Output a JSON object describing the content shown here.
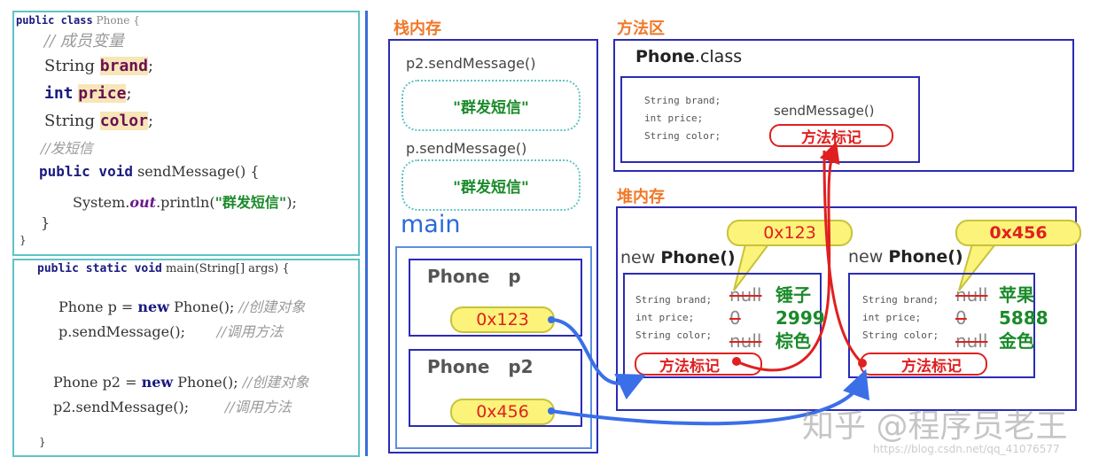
{
  "code_class": {
    "line1_kw": "public class",
    "line1_name": "Phone {",
    "comment1": "// 成员变量",
    "f1_type": "String",
    "f1_name": "brand",
    "f2_type": "int",
    "f2_name": "price",
    "f3_type": "String",
    "f3_name": "color",
    "comment2": "//发短信",
    "method_kw": "public void",
    "method_sig": "sendMessage() {",
    "print_pre": "System.",
    "print_out": "out",
    "print_mid": ".println(",
    "print_str": "\"群发短信\"",
    "print_end": ");",
    "close_inner": "}",
    "close_outer": "}"
  },
  "code_main": {
    "sig_kw": "public static void",
    "sig_rest": "main(String[] args) {",
    "l1": "Phone p = ",
    "l1_new": "new",
    "l1_rest": " Phone();",
    "l1_cmt": "//创建对象",
    "l2": "p.sendMessage();",
    "l2_cmt": "//调用方法",
    "l3": "Phone p2 = ",
    "l3_new": "new",
    "l3_rest": " Phone();",
    "l3_cmt": "//创建对象",
    "l4": "p2.sendMessage();",
    "l4_cmt": "//调用方法",
    "close": "}"
  },
  "stack": {
    "title": "栈内存",
    "frame1_label": "p2.sendMessage()",
    "frame1_text": "\"群发短信\"",
    "frame2_label": "p.sendMessage()",
    "frame2_text": "\"群发短信\"",
    "main_label": "main",
    "var1": "Phone   p",
    "var1_val": "0x123",
    "var2": "Phone   p2",
    "var2_val": "0x456"
  },
  "method_area": {
    "title": "方法区",
    "class_bold": "Phone",
    "class_rest": ".class",
    "f1": "String brand;",
    "f2": "int price;",
    "f3": "String color;",
    "method": "sendMessage()",
    "mark": "方法标记"
  },
  "heap": {
    "title": "堆内存",
    "objects": [
      {
        "new": "new",
        "name": "Phone()",
        "addr": "0x123",
        "fields": [
          "String brand;",
          "int price;",
          "String color;"
        ],
        "defaults": [
          "null",
          "0",
          "null"
        ],
        "values": [
          "锤子",
          "2999",
          "棕色"
        ],
        "mark": "方法标记"
      },
      {
        "new": "new",
        "name": "Phone()",
        "addr": "0x456",
        "fields": [
          "String brand;",
          "int price;",
          "String color;"
        ],
        "defaults": [
          "null",
          "0",
          "null"
        ],
        "values": [
          "苹果",
          "5888",
          "金色"
        ],
        "mark": "方法标记"
      }
    ]
  },
  "watermark": {
    "text": "知乎 @程序员老王",
    "url": "https://blog.csdn.net/qq_41076577"
  },
  "colors": {
    "teal": "#5ec3c8",
    "navy": "#2b2bb5",
    "red": "#e02020",
    "green": "#1a8a2a",
    "orange": "#f07828",
    "yellow": "#fbf37a"
  }
}
